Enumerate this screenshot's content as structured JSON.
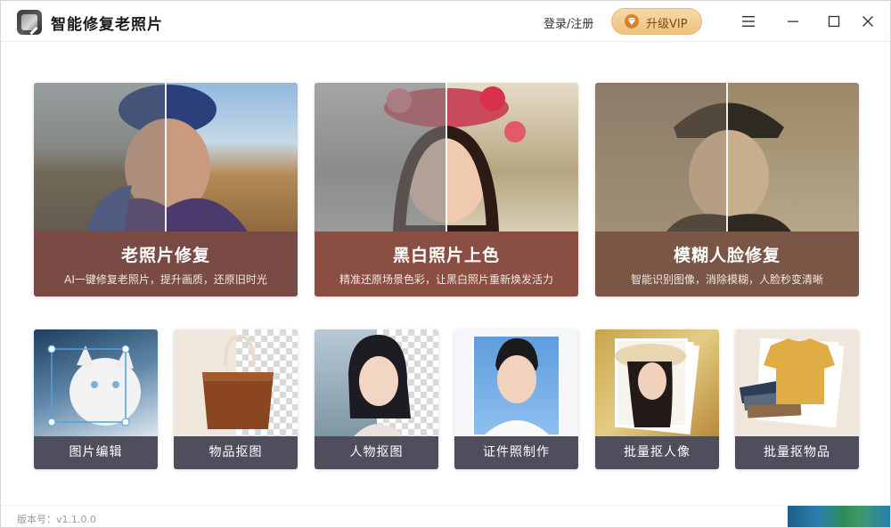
{
  "app": {
    "title": "智能修复老照片",
    "login_label": "登录/注册",
    "vip_label": "升级VIP",
    "version": "版本号：v1.1.0.0"
  },
  "icons": {
    "menu": "hamburger-icon",
    "minimize": "minimize-icon",
    "maximize": "maximize-icon",
    "close": "close-icon",
    "vip": "diamond-icon"
  },
  "colors": {
    "vip_gradient_top": "#f7d9a6",
    "vip_gradient_bottom": "#efc27f",
    "card_caption_1": "#7a4b45",
    "card_caption_2": "#8a4e42",
    "card_caption_3": "#7a5646",
    "small_caption": "#4e4e5d"
  },
  "feature_cards": [
    {
      "title": "老照片修复",
      "subtitle": "AI一键修复老照片，提升画质，还原旧时光"
    },
    {
      "title": "黑白照片上色",
      "subtitle": "精准还原场景色彩，让黑白照片重新焕发活力"
    },
    {
      "title": "模糊人脸修复",
      "subtitle": "智能识别图像，消除模糊，人脸秒变清晰"
    }
  ],
  "tool_cards": [
    {
      "label": "图片编辑"
    },
    {
      "label": "物品抠图"
    },
    {
      "label": "人物抠图"
    },
    {
      "label": "证件照制作"
    },
    {
      "label": "批量抠人像"
    },
    {
      "label": "批量抠物品"
    }
  ]
}
